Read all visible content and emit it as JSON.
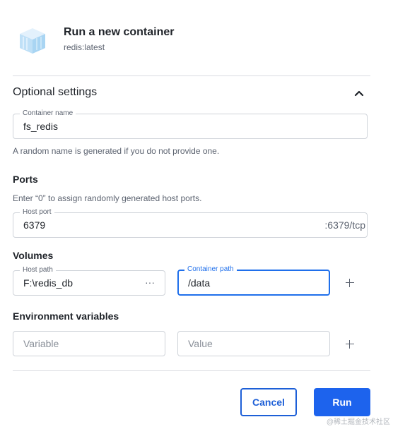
{
  "header": {
    "title": "Run a new container",
    "image": "redis:latest",
    "icon": "container-icon"
  },
  "optional_settings": {
    "title": "Optional settings",
    "toggle_icon": "chevron-up-icon",
    "expanded": true
  },
  "container_name": {
    "label": "Container name",
    "value": "fs_redis",
    "helper": "A random name is generated if you do not provide one."
  },
  "ports": {
    "heading": "Ports",
    "helper": "Enter “0” to assign randomly generated host ports.",
    "host_port_label": "Host port",
    "host_port_value": "6379",
    "container_port": ":6379/tcp"
  },
  "volumes": {
    "heading": "Volumes",
    "host_path_label": "Host path",
    "host_path_value": "F:\\redis_db",
    "browse_label": "···",
    "container_path_label": "Container path",
    "container_path_value": "/data",
    "add_icon": "plus-icon"
  },
  "env": {
    "heading": "Environment variables",
    "variable_placeholder": "Variable",
    "value_placeholder": "Value",
    "add_icon": "plus-icon"
  },
  "actions": {
    "cancel": "Cancel",
    "run": "Run"
  },
  "watermark": "@稀土掘金技术社区",
  "colors": {
    "accent": "#1d63ed",
    "focus": "#1f6feb"
  }
}
